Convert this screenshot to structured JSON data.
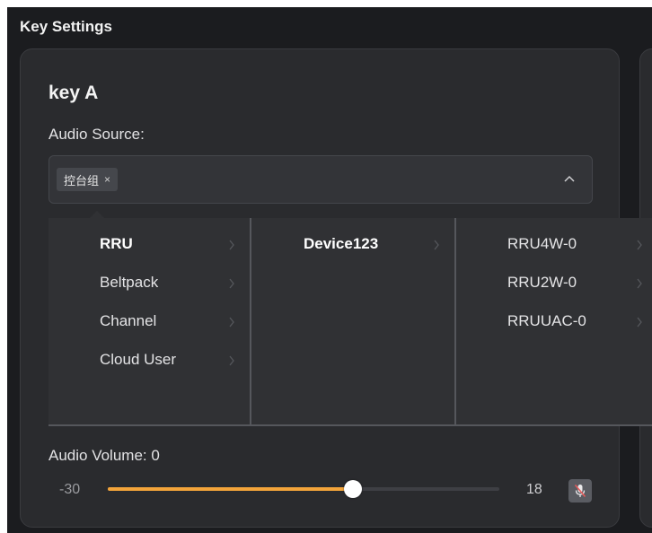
{
  "page": {
    "title": "Key Settings"
  },
  "key": {
    "title": "key A",
    "audio_source_label": "Audio Source:",
    "selected_tags": [
      "控台组"
    ],
    "tag_close_symbol": "×"
  },
  "cascader": {
    "level1": [
      "RRU",
      "Beltpack",
      "Channel",
      "Cloud User"
    ],
    "level1_active": "RRU",
    "level2": [
      "Device123"
    ],
    "level2_active": "Device123",
    "level3": [
      "RRU4W-0",
      "RRU2W-0",
      "RRUUAC-0"
    ]
  },
  "volume": {
    "label": "Audio Volume: 0",
    "min_label": "-30",
    "max_label": "18",
    "min": -30,
    "max": 18,
    "value": 0
  },
  "colors": {
    "accent": "#f3a43a",
    "background": "#1b1c1f",
    "card": "#2a2b2e"
  },
  "icons": {
    "select_arrow": "chevron-up-icon",
    "cascader_chevron": "chevron-right-icon",
    "mute": "mic-muted-icon"
  }
}
